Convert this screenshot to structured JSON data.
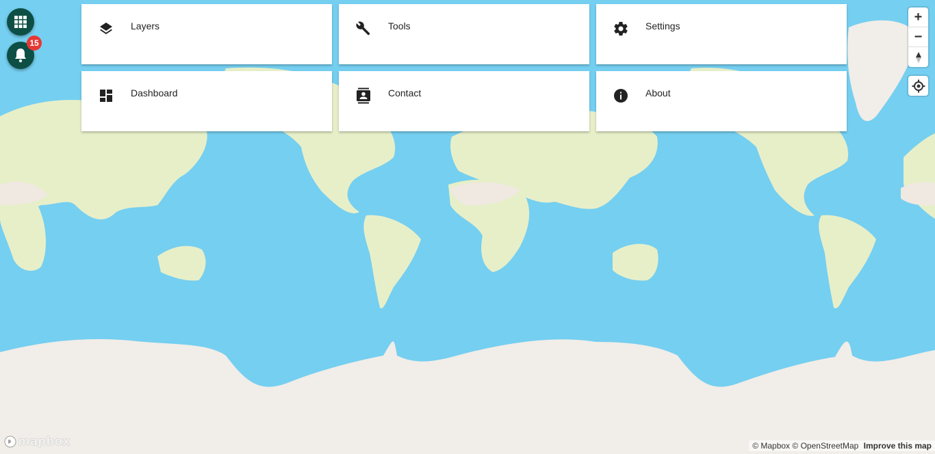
{
  "map": {
    "colors": {
      "ocean": "#75cff0",
      "land": "#e7efc9",
      "desert": "#efe9e1",
      "ice": "#f1ede8"
    }
  },
  "apps_button": {
    "icon": "apps-grid-icon"
  },
  "notifications": {
    "icon": "bell-icon",
    "badge_count": "15",
    "badge_color": "#e53935"
  },
  "menu": {
    "items": [
      {
        "label": "Layers",
        "icon": "layers-icon"
      },
      {
        "label": "Tools",
        "icon": "wrench-icon"
      },
      {
        "label": "Settings",
        "icon": "gear-icon"
      },
      {
        "label": "Dashboard",
        "icon": "dashboard-icon"
      },
      {
        "label": "Contact",
        "icon": "contact-icon"
      },
      {
        "label": "About",
        "icon": "info-icon"
      }
    ]
  },
  "controls": {
    "zoom_in": "+",
    "zoom_out": "−"
  },
  "footer": {
    "logo": "mapbox",
    "attribution_mapbox": "© Mapbox",
    "attribution_osm": "© OpenStreetMap",
    "improve": "Improve this map"
  }
}
